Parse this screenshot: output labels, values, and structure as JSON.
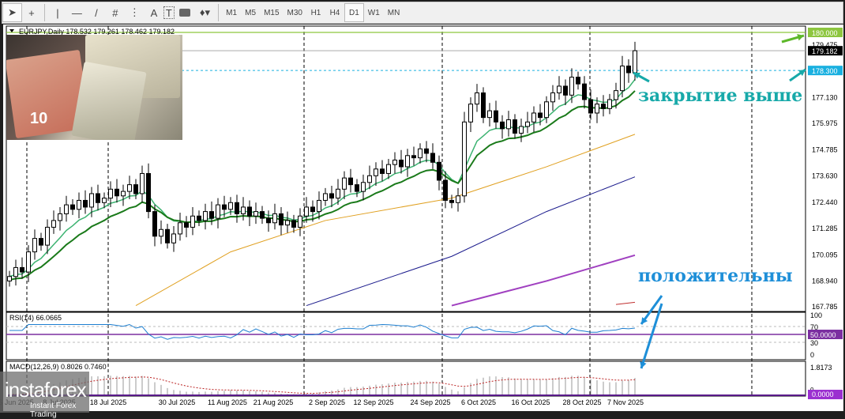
{
  "toolbar": {
    "tools": [
      "cursor-icon",
      "crosshair-icon",
      "vertical-line-icon",
      "horizontal-line-icon",
      "trendline-icon",
      "fibo-icon",
      "grid-icon",
      "A",
      "T",
      "rectangle-icon",
      "shapes-icon"
    ],
    "timeframes": [
      "M1",
      "M5",
      "M15",
      "M30",
      "H1",
      "H4",
      "D1",
      "W1",
      "MN"
    ],
    "active_timeframe": "D1"
  },
  "chart": {
    "header": "EURJPY,Daily  178.532 179.261 178.462 179.182",
    "price_labels": [
      "179.475",
      "177.130",
      "175.975",
      "174.785",
      "173.630",
      "172.440",
      "171.285",
      "170.095",
      "168.940",
      "167.785"
    ],
    "level_180": "180.000",
    "current_price": "179.182",
    "level_1783": "178.300",
    "dates": [
      "26 Jun 2025",
      "8 Jul 2025",
      "18 Jul 2025",
      "30 Jul 2025",
      "11 Aug 2025",
      "21 Aug 2025",
      "2 Sep 2025",
      "12 Sep 2025",
      "24 Sep 2025",
      "6 Oct 2025",
      "16 Oct 2025",
      "28 Oct 2025",
      "7 Nov 2025"
    ],
    "colors": {
      "bull": "#ffffff",
      "bear": "#000000",
      "ema_fast": "#3cb371",
      "ema_slow": "#1a7a1a",
      "ma50": "#e0a020",
      "ma100": "#1a1a8c",
      "ma200": "#a040c0",
      "level180": "#8dc63f",
      "level1783": "#1ab0e0"
    }
  },
  "rsi": {
    "label": "RSI(14) 66.0665",
    "levels": [
      "100",
      "70",
      "50.0000",
      "30",
      "0"
    ]
  },
  "macd": {
    "label": "MACD(12,26,9) 0.8026 0.7460",
    "levels": [
      "1.8173",
      "0",
      "0.0000"
    ]
  },
  "annotations": {
    "close_above": "закрытие выше",
    "positive": "положительны"
  },
  "watermark": {
    "brand": "instaforex",
    "tagline": "Instant Forex Trading"
  },
  "chart_data": {
    "type": "candlestick",
    "symbol": "EURJPY",
    "timeframe": "Daily",
    "ylim": [
      167.785,
      180.0
    ],
    "closes": [
      169.1,
      169.5,
      169.3,
      170.2,
      170.8,
      170.5,
      171.3,
      171.6,
      171.9,
      172.3,
      172.1,
      172.5,
      172.2,
      172.8,
      172.4,
      172.6,
      173.0,
      172.7,
      172.9,
      173.2,
      172.8,
      173.7,
      172.0,
      170.9,
      171.2,
      170.6,
      171.0,
      171.5,
      171.3,
      171.8,
      171.6,
      172.0,
      171.7,
      172.3,
      172.1,
      172.4,
      171.9,
      172.2,
      171.8,
      172.0,
      171.7,
      171.5,
      171.9,
      171.4,
      171.6,
      171.3,
      171.8,
      172.2,
      172.0,
      172.5,
      172.8,
      172.6,
      173.0,
      173.5,
      173.2,
      172.9,
      173.3,
      173.6,
      173.9,
      173.7,
      174.1,
      174.3,
      174.0,
      174.5,
      174.4,
      174.8,
      174.6,
      174.2,
      173.4,
      172.5,
      172.4,
      172.7,
      176.0,
      176.8,
      177.3,
      176.2,
      176.5,
      176.0,
      175.7,
      176.1,
      175.5,
      175.8,
      176.0,
      176.4,
      176.2,
      176.9,
      177.3,
      177.6,
      177.2,
      178.0,
      177.7,
      177.0,
      176.4,
      176.8,
      176.6,
      177.0,
      177.4,
      178.5,
      178.2,
      179.182
    ],
    "ma50": [
      [
        20,
        167.8
      ],
      [
        35,
        170.2
      ],
      [
        50,
        171.6
      ],
      [
        70,
        172.6
      ],
      [
        85,
        174.0
      ],
      [
        99,
        175.45
      ]
    ],
    "ma100": [
      [
        47,
        167.8
      ],
      [
        70,
        170.0
      ],
      [
        85,
        172.0
      ],
      [
        99,
        173.55
      ]
    ],
    "ma200": [
      [
        70,
        167.8
      ],
      [
        85,
        168.9
      ],
      [
        99,
        170.05
      ]
    ],
    "rsi_last": 66.0665,
    "macd_last": 0.8026,
    "signal_last": 0.746
  }
}
